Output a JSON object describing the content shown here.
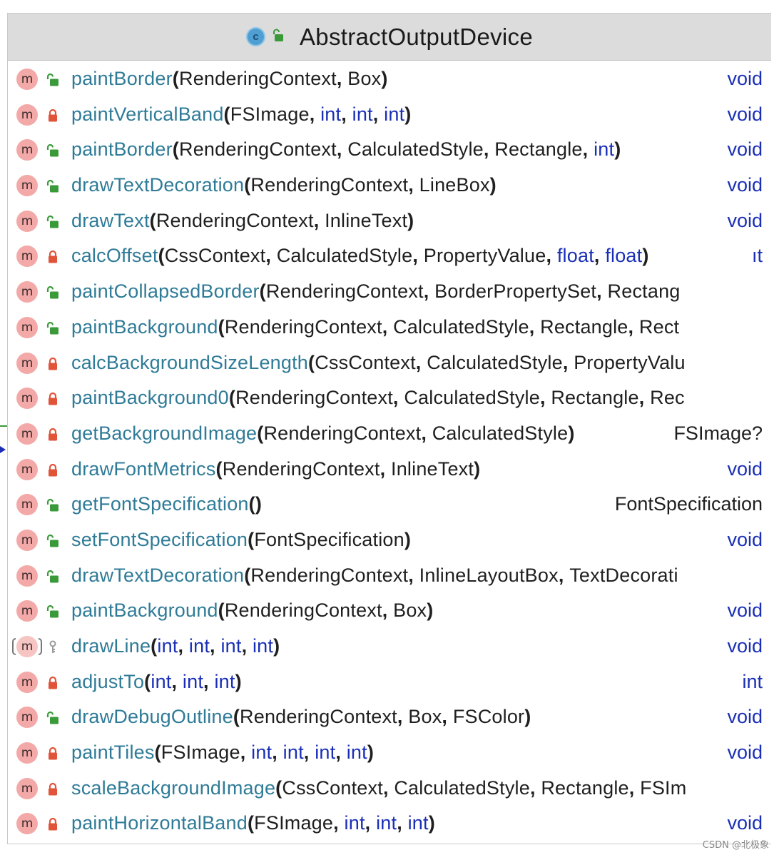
{
  "header": {
    "class_icon": "c",
    "title": "AbstractOutputDevice"
  },
  "methods": [
    {
      "name": "paintBorder",
      "params": [
        {
          "t": "RenderingContext",
          "k": "obj"
        },
        {
          "t": "Box",
          "k": "obj"
        }
      ],
      "close": ")",
      "ret": "void",
      "retk": "prim",
      "vis": "public",
      "kind": "m"
    },
    {
      "name": "paintVerticalBand",
      "params": [
        {
          "t": "FSImage",
          "k": "obj"
        },
        {
          "t": "int",
          "k": "prim"
        },
        {
          "t": "int",
          "k": "prim"
        },
        {
          "t": "int",
          "k": "prim"
        }
      ],
      "close": ")",
      "ret": "void",
      "retk": "prim",
      "vis": "private",
      "kind": "m"
    },
    {
      "name": "paintBorder",
      "params": [
        {
          "t": "RenderingContext",
          "k": "obj"
        },
        {
          "t": "CalculatedStyle",
          "k": "obj"
        },
        {
          "t": "Rectangle",
          "k": "obj"
        },
        {
          "t": "int",
          "k": "prim"
        }
      ],
      "close": ")",
      "ret": "void",
      "retk": "prim",
      "vis": "public",
      "kind": "m"
    },
    {
      "name": "drawTextDecoration",
      "params": [
        {
          "t": "RenderingContext",
          "k": "obj"
        },
        {
          "t": "LineBox",
          "k": "obj"
        }
      ],
      "close": ")",
      "ret": "void",
      "retk": "prim",
      "vis": "public",
      "kind": "m"
    },
    {
      "name": "drawText",
      "params": [
        {
          "t": "RenderingContext",
          "k": "obj"
        },
        {
          "t": "InlineText",
          "k": "obj"
        }
      ],
      "close": ")",
      "ret": "void",
      "retk": "prim",
      "vis": "public",
      "kind": "m"
    },
    {
      "name": "calcOffset",
      "params": [
        {
          "t": "CssContext",
          "k": "obj"
        },
        {
          "t": "CalculatedStyle",
          "k": "obj"
        },
        {
          "t": "PropertyValue",
          "k": "obj"
        },
        {
          "t": "float",
          "k": "prim"
        },
        {
          "t": "float",
          "k": "prim"
        }
      ],
      "close": ")",
      "ret": "ıt",
      "retk": "prim",
      "vis": "private",
      "kind": "m"
    },
    {
      "name": "paintCollapsedBorder",
      "params": [
        {
          "t": "RenderingContext",
          "k": "obj"
        },
        {
          "t": "BorderPropertySet",
          "k": "obj"
        },
        {
          "t": "Rectang",
          "k": "obj"
        }
      ],
      "close": "",
      "ret": "",
      "retk": "",
      "vis": "public",
      "kind": "m"
    },
    {
      "name": "paintBackground",
      "params": [
        {
          "t": "RenderingContext",
          "k": "obj"
        },
        {
          "t": "CalculatedStyle",
          "k": "obj"
        },
        {
          "t": "Rectangle",
          "k": "obj"
        },
        {
          "t": "Rect",
          "k": "obj"
        }
      ],
      "close": "",
      "ret": "",
      "retk": "",
      "vis": "public",
      "kind": "m"
    },
    {
      "name": "calcBackgroundSizeLength",
      "params": [
        {
          "t": "CssContext",
          "k": "obj"
        },
        {
          "t": "CalculatedStyle",
          "k": "obj"
        },
        {
          "t": "PropertyValu",
          "k": "obj"
        }
      ],
      "close": "",
      "ret": "",
      "retk": "",
      "vis": "private",
      "kind": "m"
    },
    {
      "name": "paintBackground0",
      "params": [
        {
          "t": "RenderingContext",
          "k": "obj"
        },
        {
          "t": "CalculatedStyle",
          "k": "obj"
        },
        {
          "t": "Rectangle",
          "k": "obj"
        },
        {
          "t": "Rec",
          "k": "obj"
        }
      ],
      "close": "",
      "ret": "",
      "retk": "",
      "vis": "private",
      "kind": "m"
    },
    {
      "name": "getBackgroundImage",
      "params": [
        {
          "t": "RenderingContext",
          "k": "obj"
        },
        {
          "t": "CalculatedStyle",
          "k": "obj"
        }
      ],
      "close": ")",
      "ret": "FSImage?",
      "retk": "obj",
      "vis": "private",
      "kind": "m"
    },
    {
      "name": "drawFontMetrics",
      "params": [
        {
          "t": "RenderingContext",
          "k": "obj"
        },
        {
          "t": "InlineText",
          "k": "obj"
        }
      ],
      "close": ")",
      "ret": "void",
      "retk": "prim",
      "vis": "private",
      "kind": "m"
    },
    {
      "name": "getFontSpecification",
      "params": [],
      "close": ")",
      "ret": "FontSpecification",
      "retk": "obj",
      "vis": "public",
      "kind": "m"
    },
    {
      "name": "setFontSpecification",
      "params": [
        {
          "t": "FontSpecification",
          "k": "obj"
        }
      ],
      "close": ")",
      "ret": "void",
      "retk": "prim",
      "vis": "public",
      "kind": "m"
    },
    {
      "name": "drawTextDecoration",
      "params": [
        {
          "t": "RenderingContext",
          "k": "obj"
        },
        {
          "t": "InlineLayoutBox",
          "k": "obj"
        },
        {
          "t": "TextDecorati",
          "k": "obj"
        }
      ],
      "close": "",
      "ret": "",
      "retk": "",
      "vis": "public",
      "kind": "m"
    },
    {
      "name": "paintBackground",
      "params": [
        {
          "t": "RenderingContext",
          "k": "obj"
        },
        {
          "t": "Box",
          "k": "obj"
        }
      ],
      "close": ")",
      "ret": "void",
      "retk": "prim",
      "vis": "public",
      "kind": "m"
    },
    {
      "name": "drawLine",
      "params": [
        {
          "t": "int",
          "k": "prim"
        },
        {
          "t": "int",
          "k": "prim"
        },
        {
          "t": "int",
          "k": "prim"
        },
        {
          "t": "int",
          "k": "prim"
        }
      ],
      "close": ")",
      "ret": "void",
      "retk": "prim",
      "vis": "package",
      "kind": "pkg"
    },
    {
      "name": "adjustTo",
      "params": [
        {
          "t": "int",
          "k": "prim"
        },
        {
          "t": "int",
          "k": "prim"
        },
        {
          "t": "int",
          "k": "prim"
        }
      ],
      "close": ")",
      "ret": "int",
      "retk": "prim",
      "vis": "private",
      "kind": "m"
    },
    {
      "name": "drawDebugOutline",
      "params": [
        {
          "t": "RenderingContext",
          "k": "obj"
        },
        {
          "t": "Box",
          "k": "obj"
        },
        {
          "t": "FSColor",
          "k": "obj"
        }
      ],
      "close": ")",
      "ret": "void",
      "retk": "prim",
      "vis": "public",
      "kind": "m"
    },
    {
      "name": "paintTiles",
      "params": [
        {
          "t": "FSImage",
          "k": "obj"
        },
        {
          "t": "int",
          "k": "prim"
        },
        {
          "t": "int",
          "k": "prim"
        },
        {
          "t": "int",
          "k": "prim"
        },
        {
          "t": "int",
          "k": "prim"
        }
      ],
      "close": ")",
      "ret": "void",
      "retk": "prim",
      "vis": "private",
      "kind": "m"
    },
    {
      "name": "scaleBackgroundImage",
      "params": [
        {
          "t": "CssContext",
          "k": "obj"
        },
        {
          "t": "CalculatedStyle",
          "k": "obj"
        },
        {
          "t": "Rectangle",
          "k": "obj"
        },
        {
          "t": "FSIm",
          "k": "obj"
        }
      ],
      "close": "",
      "ret": "",
      "retk": "",
      "vis": "private",
      "kind": "m"
    },
    {
      "name": "paintHorizontalBand",
      "params": [
        {
          "t": "FSImage",
          "k": "obj"
        },
        {
          "t": "int",
          "k": "prim"
        },
        {
          "t": "int",
          "k": "prim"
        },
        {
          "t": "int",
          "k": "prim"
        }
      ],
      "close": ")",
      "ret": "void",
      "retk": "prim",
      "vis": "private",
      "kind": "m"
    }
  ],
  "icons": {
    "method": "m",
    "public": "open-lock-icon",
    "private": "lock-icon",
    "package": "key-icon"
  },
  "colors": {
    "method_name": "#2f7b97",
    "primitive": "#1a2fb6",
    "method_badge": "#f3a9a7",
    "private_lock": "#e0543a",
    "public_lock": "#3a9a3a"
  },
  "watermark": "CSDN @北极象"
}
